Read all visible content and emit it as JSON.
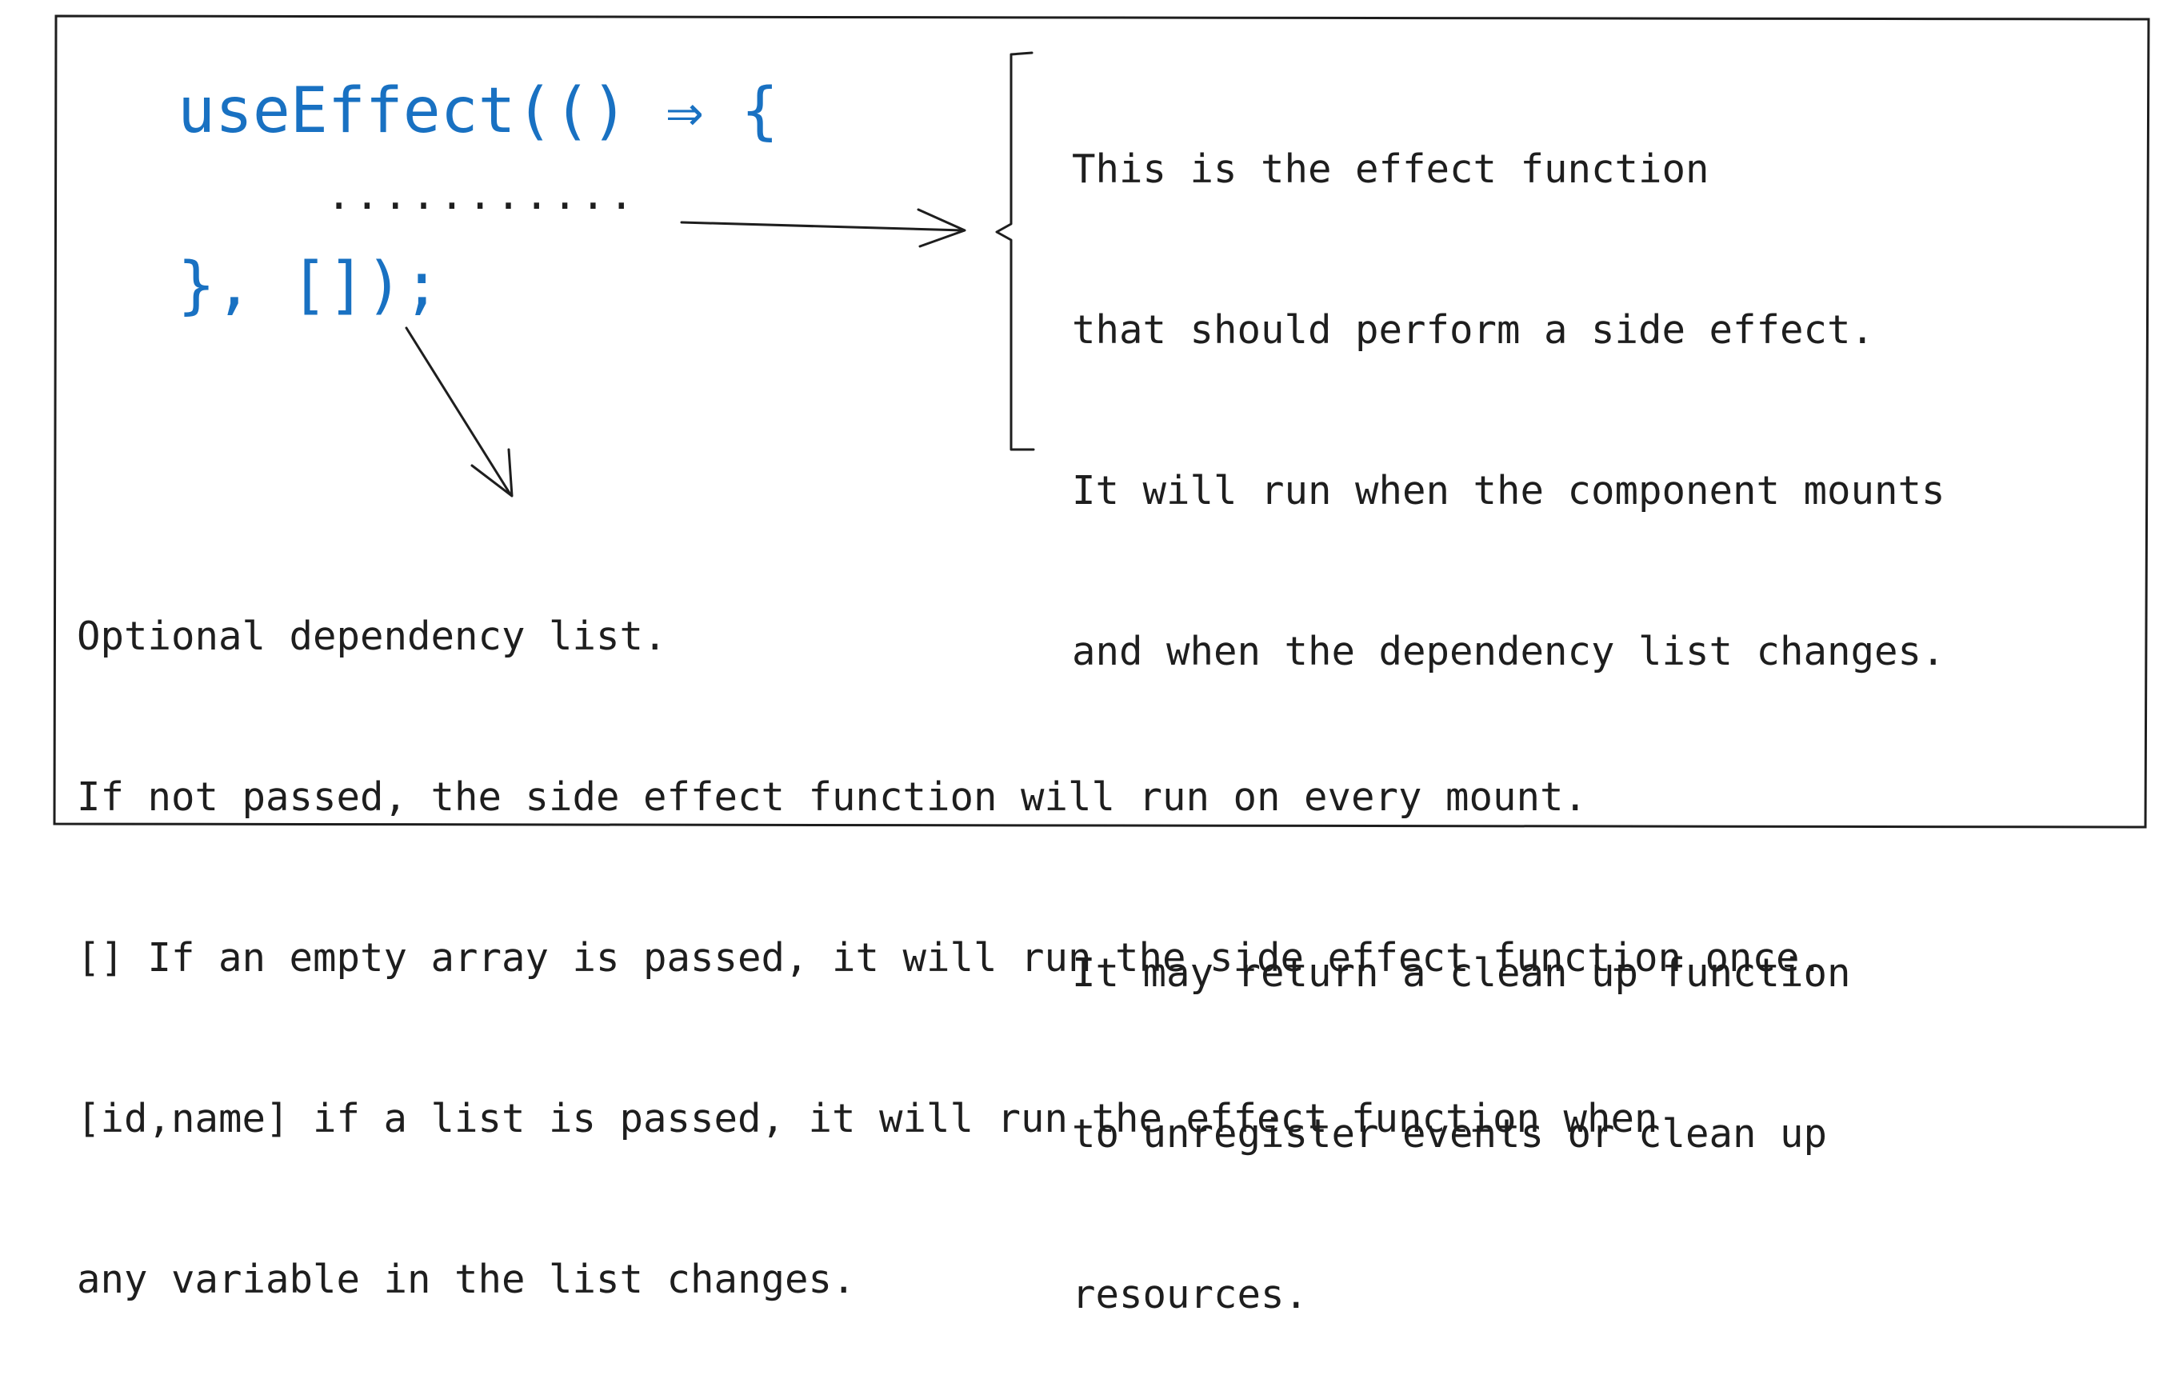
{
  "code": {
    "line1": "useEffect(() ⇒ {",
    "dots": "...........",
    "line3": "}, []);"
  },
  "effect_note": {
    "paragraph1": [
      "This is the effect function",
      "that should perform a side effect.",
      "It will run when the component mounts",
      "and when the dependency list changes."
    ],
    "paragraph2": [
      "It may return a clean up function",
      "to unregister events or clean up",
      "resources."
    ]
  },
  "dependency_note": [
    "Optional dependency list.",
    "If not passed, the side effect function will run on every mount.",
    "[] If an empty array is passed, it will run the side effect function once.",
    "[id,name] if a list is passed, it will run the effect function when",
    "any variable in the list changes."
  ],
  "colors": {
    "code": "#1971c2",
    "stroke": "#1e1e1e"
  }
}
